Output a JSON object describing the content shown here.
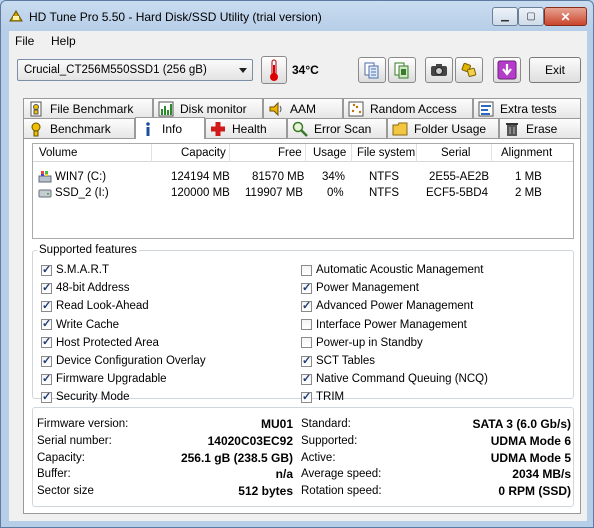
{
  "window": {
    "title": "HD Tune Pro 5.50 - Hard Disk/SSD Utility (trial version)"
  },
  "menu": [
    {
      "label": "File"
    },
    {
      "label": "Help"
    }
  ],
  "toolbar": {
    "drive": "Crucial_CT256M550SSD1 (256 gB)",
    "temperature": "34°C",
    "exit_label": "Exit",
    "icons": [
      "copy-text-icon",
      "copy-screenshot-icon",
      "camera-icon",
      "options-icon",
      "save-icon"
    ]
  },
  "tabs_row1": [
    {
      "label": "File Benchmark",
      "icon": "file-benchmark-icon"
    },
    {
      "label": "Disk monitor",
      "icon": "disk-monitor-icon"
    },
    {
      "label": "AAM",
      "icon": "speaker-icon"
    },
    {
      "label": "Random Access",
      "icon": "random-access-icon"
    },
    {
      "label": "Extra tests",
      "icon": "extra-tests-icon"
    }
  ],
  "tabs_row2": [
    {
      "label": "Benchmark",
      "icon": "benchmark-icon"
    },
    {
      "label": "Info",
      "icon": "info-icon"
    },
    {
      "label": "Health",
      "icon": "health-cross-icon"
    },
    {
      "label": "Error Scan",
      "icon": "magnifier-icon"
    },
    {
      "label": "Folder Usage",
      "icon": "folder-icon"
    },
    {
      "label": "Erase",
      "icon": "trash-icon"
    }
  ],
  "volumes": {
    "headers": [
      "Volume",
      "Capacity",
      "Free",
      "Usage",
      "File system",
      "Serial",
      "Alignment"
    ],
    "rows": [
      [
        "WIN7 (C:)",
        "124194 MB",
        "81570 MB",
        "34%",
        "NTFS",
        "2E55-AE2B",
        "1 MB"
      ],
      [
        "SSD_2 (I:)",
        "120000 MB",
        "119907 MB",
        "0%",
        "NTFS",
        "ECF5-5BD4",
        "2 MB"
      ]
    ]
  },
  "features": {
    "legend": "Supported features",
    "left": [
      {
        "label": "S.M.A.R.T",
        "checked": true
      },
      {
        "label": "48-bit Address",
        "checked": true
      },
      {
        "label": "Read Look-Ahead",
        "checked": true
      },
      {
        "label": "Write Cache",
        "checked": true
      },
      {
        "label": "Host Protected Area",
        "checked": true
      },
      {
        "label": "Device Configuration Overlay",
        "checked": true
      },
      {
        "label": "Firmware Upgradable",
        "checked": true
      },
      {
        "label": "Security Mode",
        "checked": true
      }
    ],
    "right": [
      {
        "label": "Automatic Acoustic Management",
        "checked": false
      },
      {
        "label": "Power Management",
        "checked": true
      },
      {
        "label": "Advanced Power Management",
        "checked": true
      },
      {
        "label": "Interface Power Management",
        "checked": false
      },
      {
        "label": "Power-up in Standby",
        "checked": false
      },
      {
        "label": "SCT Tables",
        "checked": true
      },
      {
        "label": "Native Command Queuing (NCQ)",
        "checked": true
      },
      {
        "label": "TRIM",
        "checked": true
      }
    ]
  },
  "info": {
    "left": [
      {
        "label": "Firmware version:",
        "value": "MU01"
      },
      {
        "label": "Serial number:",
        "value": "14020C03EC92"
      },
      {
        "label": "Capacity:",
        "value": "256.1 gB (238.5 GB)"
      },
      {
        "label": "Buffer:",
        "value": "n/a"
      },
      {
        "label": "Sector size",
        "value": "512 bytes"
      }
    ],
    "right": [
      {
        "label": "Standard:",
        "value": "SATA 3 (6.0 Gb/s)"
      },
      {
        "label": "Supported:",
        "value": "UDMA Mode 6"
      },
      {
        "label": "Active:",
        "value": "UDMA Mode 5"
      },
      {
        "label": "Average speed:",
        "value": "2034 MB/s"
      },
      {
        "label": "Rotation speed:",
        "value": "0 RPM (SSD)"
      }
    ]
  }
}
